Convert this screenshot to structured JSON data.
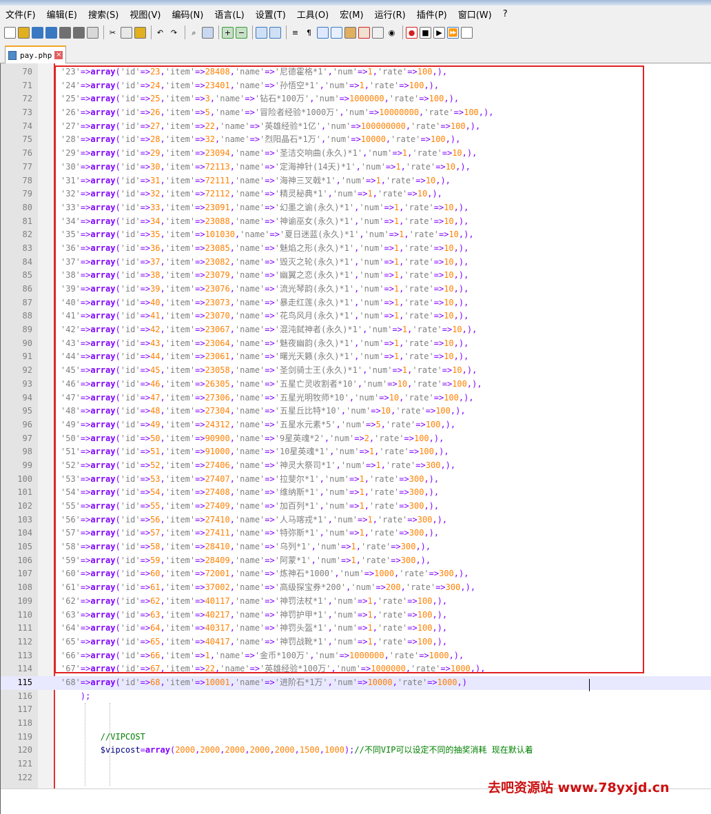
{
  "menu": [
    "文件(F)",
    "编辑(E)",
    "搜索(S)",
    "视图(V)",
    "编码(N)",
    "语言(L)",
    "设置(T)",
    "工具(O)",
    "宏(M)",
    "运行(R)",
    "插件(P)",
    "窗口(W)",
    "?"
  ],
  "toolbar": {
    "icons": [
      "new-file-icon",
      "open-file-icon",
      "save-icon",
      "save-all-icon",
      "close-icon",
      "close-all-icon",
      "print-icon",
      "|",
      "cut-icon",
      "copy-icon",
      "paste-icon",
      "|",
      "undo-icon",
      "redo-icon",
      "|",
      "find-icon",
      "replace-icon",
      "|",
      "zoom-in-icon",
      "zoom-out-icon",
      "|",
      "sync-vertical-icon",
      "sync-horizontal-icon",
      "|",
      "word-wrap-icon",
      "show-all-chars-icon",
      "indent-guide-icon",
      "user-lang-icon",
      "doc-map-icon",
      "function-list-icon",
      "folder-workspace-icon",
      "monitor-icon",
      "|",
      "record-macro-icon",
      "stop-macro-icon",
      "play-macro-icon",
      "run-macro-multiple-icon",
      "save-macro-icon"
    ],
    "colors": {
      "red": "#d42020",
      "blue": "#3a78c2",
      "green": "#3a9a3a",
      "gray": "#707070",
      "yellow": "#e0b020"
    }
  },
  "tab": {
    "filename": "pay.php",
    "close_glyph": "×"
  },
  "editor": {
    "lines": [
      {
        "n": "70",
        "code": "'23'=>array('id'=>23,'item'=>28408,'name'=>'尼德霍格*1','num'=>1,'rate'=>100,),"
      },
      {
        "n": "71",
        "code": "'24'=>array('id'=>24,'item'=>23401,'name'=>'孙悟空*1','num'=>1,'rate'=>100,),"
      },
      {
        "n": "72",
        "code": "'25'=>array('id'=>25,'item'=>3,'name'=>'钻石*100万','num'=>1000000,'rate'=>100,),"
      },
      {
        "n": "73",
        "code": "'26'=>array('id'=>26,'item'=>5,'name'=>'冒险者经验*1000万','num'=>10000000,'rate'=>100,),"
      },
      {
        "n": "74",
        "code": "'27'=>array('id'=>27,'item'=>22,'name'=>'英雄经验*1亿','num'=>100000000,'rate'=>100,),"
      },
      {
        "n": "75",
        "code": "'28'=>array('id'=>28,'item'=>32,'name'=>'烈阳晶石*1万','num'=>10000,'rate'=>100,),"
      },
      {
        "n": "76",
        "code": "'29'=>array('id'=>29,'item'=>23094,'name'=>'圣洁交响曲(永久)*1','num'=>1,'rate'=>10,),"
      },
      {
        "n": "77",
        "code": "'30'=>array('id'=>30,'item'=>72113,'name'=>'定海神针(14天)*1','num'=>1,'rate'=>10,),"
      },
      {
        "n": "78",
        "code": "'31'=>array('id'=>31,'item'=>72111,'name'=>'海神三叉戟*1','num'=>1,'rate'=>10,),"
      },
      {
        "n": "79",
        "code": "'32'=>array('id'=>32,'item'=>72112,'name'=>'精灵秘典*1','num'=>1,'rate'=>10,),"
      },
      {
        "n": "80",
        "code": "'33'=>array('id'=>33,'item'=>23091,'name'=>'幻墨之谕(永久)*1','num'=>1,'rate'=>10,),"
      },
      {
        "n": "81",
        "code": "'34'=>array('id'=>34,'item'=>23088,'name'=>'神谕巫女(永久)*1','num'=>1,'rate'=>10,),"
      },
      {
        "n": "82",
        "code": "'35'=>array('id'=>35,'item'=>101030,'name'=>'夏日迷蓝(永久)*1','num'=>1,'rate'=>10,),"
      },
      {
        "n": "83",
        "code": "'36'=>array('id'=>36,'item'=>23085,'name'=>'魅焰之形(永久)*1','num'=>1,'rate'=>10,),"
      },
      {
        "n": "84",
        "code": "'37'=>array('id'=>37,'item'=>23082,'name'=>'毁灭之轮(永久)*1','num'=>1,'rate'=>10,),"
      },
      {
        "n": "85",
        "code": "'38'=>array('id'=>38,'item'=>23079,'name'=>'幽翼之恋(永久)*1','num'=>1,'rate'=>10,),"
      },
      {
        "n": "86",
        "code": "'39'=>array('id'=>39,'item'=>23076,'name'=>'流光琴韵(永久)*1','num'=>1,'rate'=>10,),"
      },
      {
        "n": "87",
        "code": "'40'=>array('id'=>40,'item'=>23073,'name'=>'暴走红莲(永久)*1','num'=>1,'rate'=>10,),"
      },
      {
        "n": "88",
        "code": "'41'=>array('id'=>41,'item'=>23070,'name'=>'花鸟风月(永久)*1','num'=>1,'rate'=>10,),"
      },
      {
        "n": "89",
        "code": "'42'=>array('id'=>42,'item'=>23067,'name'=>'混沌弑神者(永久)*1','num'=>1,'rate'=>10,),"
      },
      {
        "n": "90",
        "code": "'43'=>array('id'=>43,'item'=>23064,'name'=>'魅夜幽韵(永久)*1','num'=>1,'rate'=>10,),"
      },
      {
        "n": "91",
        "code": "'44'=>array('id'=>44,'item'=>23061,'name'=>'曙光天籁(永久)*1','num'=>1,'rate'=>10,),"
      },
      {
        "n": "92",
        "code": "'45'=>array('id'=>45,'item'=>23058,'name'=>'圣剑骑士王(永久)*1','num'=>1,'rate'=>10,),"
      },
      {
        "n": "93",
        "code": "'46'=>array('id'=>46,'item'=>26305,'name'=>'五星亡灵收割者*10','num'=>10,'rate'=>100,),"
      },
      {
        "n": "94",
        "code": "'47'=>array('id'=>47,'item'=>27306,'name'=>'五星光明牧师*10','num'=>10,'rate'=>100,),"
      },
      {
        "n": "95",
        "code": "'48'=>array('id'=>48,'item'=>27304,'name'=>'五星丘比特*10','num'=>10,'rate'=>100,),"
      },
      {
        "n": "96",
        "code": "'49'=>array('id'=>49,'item'=>24312,'name'=>'五星水元素*5','num'=>5,'rate'=>100,),"
      },
      {
        "n": "97",
        "code": "'50'=>array('id'=>50,'item'=>90900,'name'=>'9星英魂*2','num'=>2,'rate'=>100,),"
      },
      {
        "n": "98",
        "code": "'51'=>array('id'=>51,'item'=>91000,'name'=>'10星英魂*1','num'=>1,'rate'=>100,),"
      },
      {
        "n": "99",
        "code": "'52'=>array('id'=>52,'item'=>27406,'name'=>'神灵大祭司*1','num'=>1,'rate'=>300,),"
      },
      {
        "n": "100",
        "code": "'53'=>array('id'=>53,'item'=>27407,'name'=>'拉斐尔*1','num'=>1,'rate'=>300,),"
      },
      {
        "n": "101",
        "code": "'54'=>array('id'=>54,'item'=>27408,'name'=>'维纳斯*1','num'=>1,'rate'=>300,),"
      },
      {
        "n": "102",
        "code": "'55'=>array('id'=>55,'item'=>27409,'name'=>'加百列*1','num'=>1,'rate'=>300,),"
      },
      {
        "n": "103",
        "code": "'56'=>array('id'=>56,'item'=>27410,'name'=>'人马喀戎*1','num'=>1,'rate'=>300,),"
      },
      {
        "n": "104",
        "code": "'57'=>array('id'=>57,'item'=>27411,'name'=>'特弥斯*1','num'=>1,'rate'=>300,),"
      },
      {
        "n": "105",
        "code": "'58'=>array('id'=>58,'item'=>28410,'name'=>'乌列*1','num'=>1,'rate'=>300,),"
      },
      {
        "n": "106",
        "code": "'59'=>array('id'=>59,'item'=>28409,'name'=>'阿蒙*1','num'=>1,'rate'=>300,),"
      },
      {
        "n": "107",
        "code": "'60'=>array('id'=>60,'item'=>72001,'name'=>'炼神石*1000','num'=>1000,'rate'=>300,),"
      },
      {
        "n": "108",
        "code": "'61'=>array('id'=>61,'item'=>37002,'name'=>'高级探宝券*200','num'=>200,'rate'=>300,),"
      },
      {
        "n": "109",
        "code": "'62'=>array('id'=>62,'item'=>40117,'name'=>'神罚法杖*1','num'=>1,'rate'=>100,),"
      },
      {
        "n": "110",
        "code": "'63'=>array('id'=>63,'item'=>40217,'name'=>'神罚护甲*1','num'=>1,'rate'=>100,),"
      },
      {
        "n": "111",
        "code": "'64'=>array('id'=>64,'item'=>40317,'name'=>'神罚头盔*1','num'=>1,'rate'=>100,),"
      },
      {
        "n": "112",
        "code": "'65'=>array('id'=>65,'item'=>40417,'name'=>'神罚战靴*1','num'=>1,'rate'=>100,),"
      },
      {
        "n": "113",
        "code": "'66'=>array('id'=>66,'item'=>1,'name'=>'金币*100万','num'=>1000000,'rate'=>1000,),"
      },
      {
        "n": "114",
        "code": "'67'=>array('id'=>67,'item'=>22,'name'=>'英雄经验*100万','num'=>1000000,'rate'=>1000,),"
      },
      {
        "n": "115",
        "code": "'68'=>array('id'=>68,'item'=>10001,'name'=>'进阶石*1万','num'=>10000,'rate'=>1000,)"
      },
      {
        "n": "116",
        "code": "    );"
      },
      {
        "n": "117",
        "code": ""
      },
      {
        "n": "118",
        "code": ""
      },
      {
        "n": "119",
        "code": "        //VIPCOST"
      },
      {
        "n": "120",
        "code": "        $vipcost=array(2000,2000,2000,2000,2000,1500,1000);//不同VIP可以设定不同的抽奖消耗 现在默认着"
      },
      {
        "n": "121",
        "code": ""
      },
      {
        "n": "122",
        "code": ""
      }
    ],
    "current_line": "115"
  },
  "watermark": "去吧资源站 www.78yxjd.cn"
}
